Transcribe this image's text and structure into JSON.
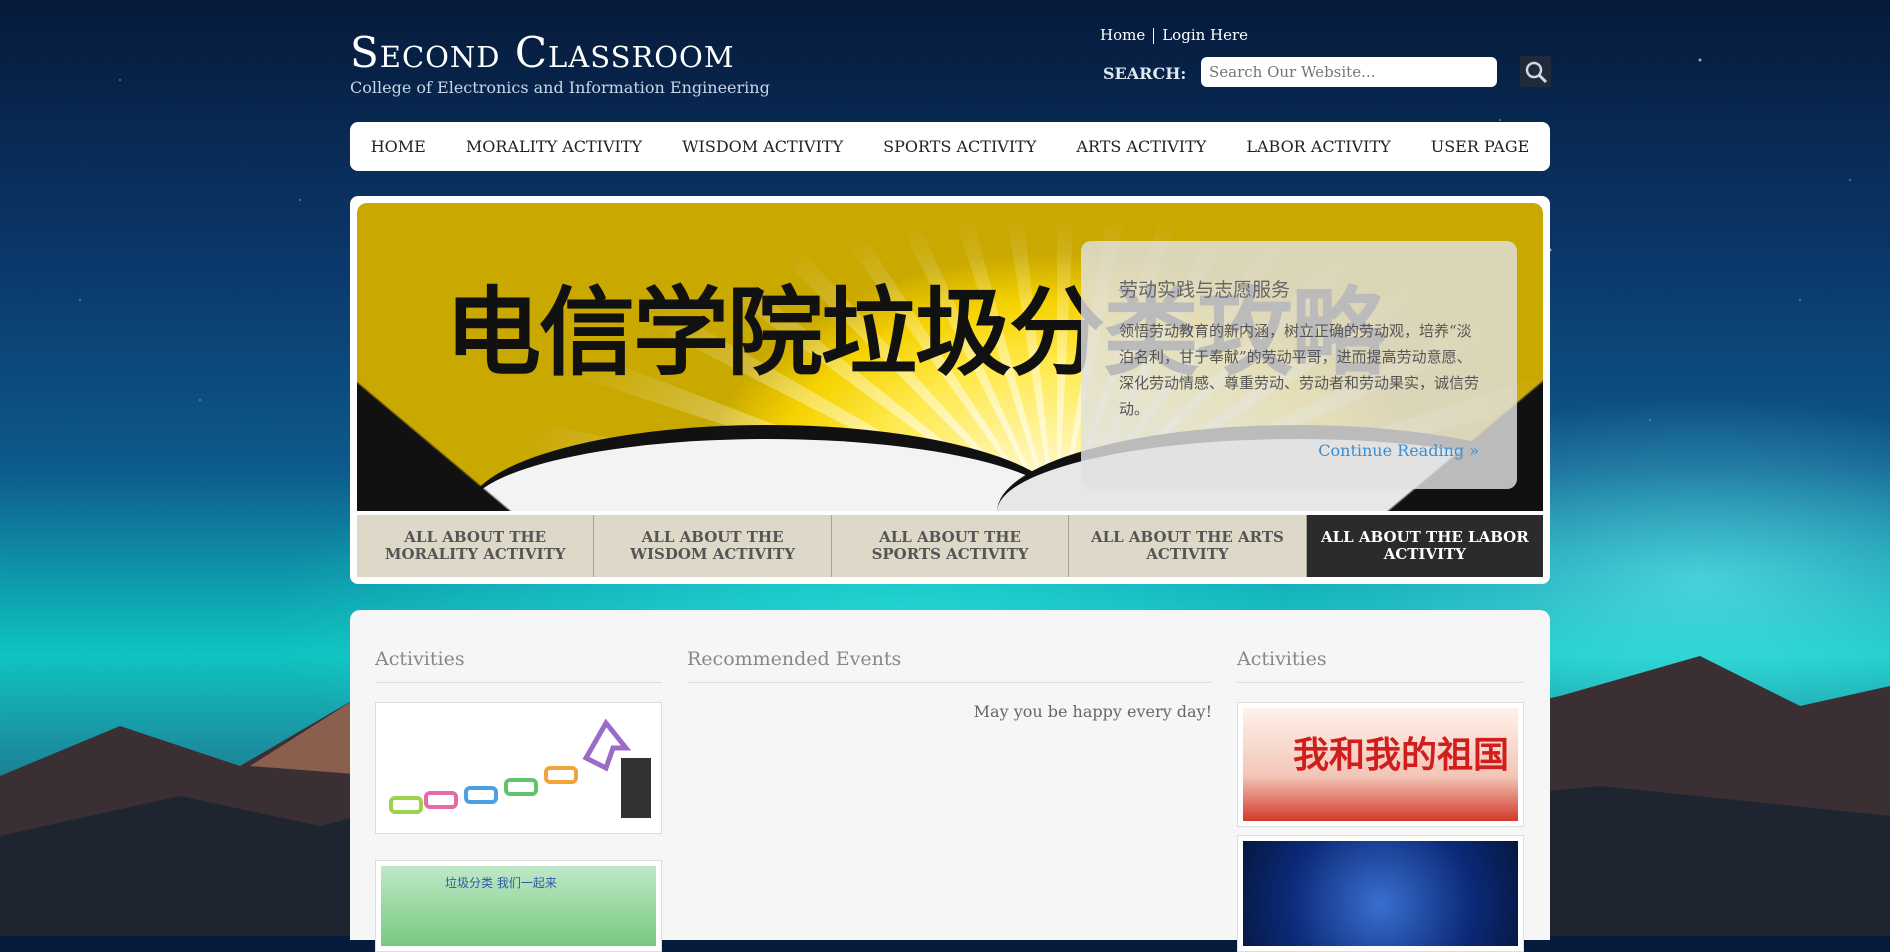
{
  "site": {
    "title": "Second Classroom",
    "subtitle": "College of Electronics and Information Engineering"
  },
  "topnav": {
    "home": "Home",
    "login": "Login Here"
  },
  "search": {
    "label": "SEARCH:",
    "placeholder": "Search Our Website...",
    "icon": "search-icon"
  },
  "mainnav": {
    "items": [
      "HOME",
      "MORALITY ACTIVITY",
      "WISDOM ACTIVITY",
      "SPORTS ACTIVITY",
      "ARTS ACTIVITY",
      "LABOR ACTIVITY",
      "USER PAGE"
    ]
  },
  "slider": {
    "headline": "电信学院垃圾分类攻略",
    "caption_title": "劳动实践与志愿服务",
    "caption_text": "领悟劳动教育的新内涵，树立正确的劳动观，培养“淡泊名利，甘于奉献”的劳动平哥，进而提高劳动意愿、深化劳动情感、尊重劳动、劳动者和劳动果实，诚信劳动。",
    "continue": "Continue Reading »",
    "tabs": [
      "ALL ABOUT THE MORALITY ACTIVITY",
      "ALL ABOUT THE WISDOM ACTIVITY",
      "ALL ABOUT THE SPORTS ACTIVITY",
      "ALL ABOUT THE ARTS ACTIVITY",
      "ALL ABOUT THE LABOR ACTIVITY"
    ],
    "active_tab": 4
  },
  "content": {
    "left_title": "Activities",
    "middle_title": "Recommended Events",
    "middle_text": "May you be happy every day!",
    "right_title": "Activities",
    "right_banner_text": "我和我的祖国",
    "left_banner_text": "垃圾分类 我们一起来"
  },
  "colors": {
    "accent_link": "#3a8fd0",
    "active_tab": "#2b2b2b",
    "tab_bg": "#ddd8c8"
  }
}
